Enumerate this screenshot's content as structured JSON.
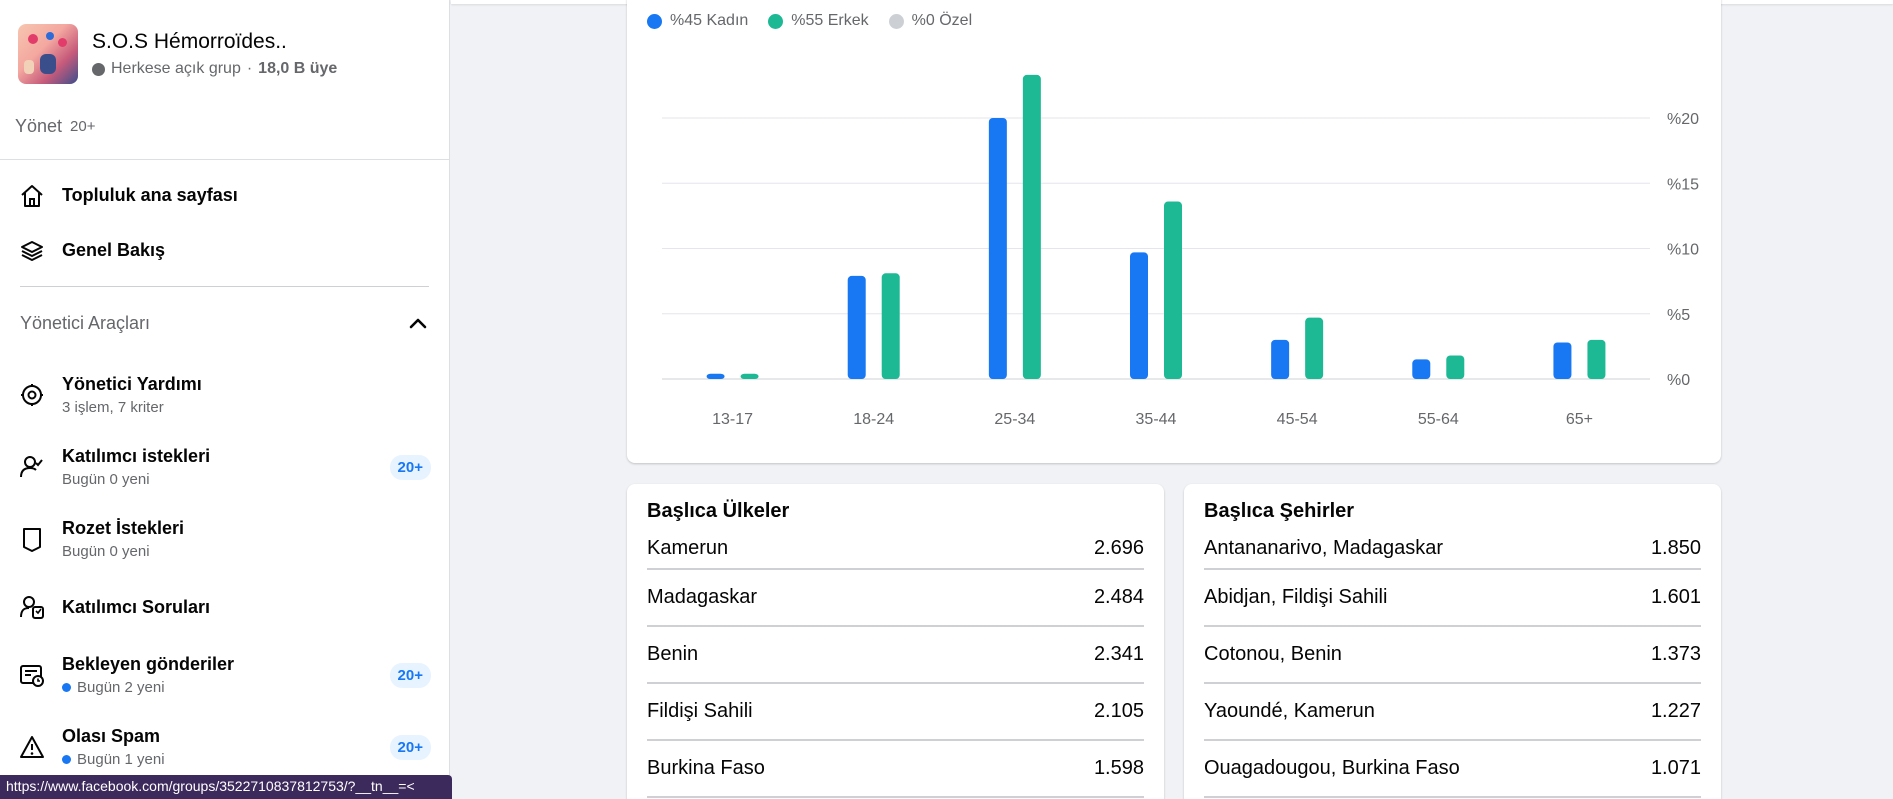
{
  "group": {
    "name": "S.O.S Hémorroïdes..",
    "privacy": "Herkese açık grup",
    "separator": "·",
    "members": "18,0 B üye"
  },
  "manage": {
    "label": "Yönet",
    "count": "20+"
  },
  "nav": [
    {
      "label": "Topluluk ana sayfası",
      "icon": "home-icon"
    },
    {
      "label": "Genel Bakış",
      "icon": "layers-icon"
    }
  ],
  "admin_tools": {
    "title": "Yönetici Araçları",
    "items": [
      {
        "title": "Yönetici Yardımı",
        "subtitle": "3 işlem, 7 kriter",
        "badge": "",
        "dot": false,
        "icon": "gear-icon"
      },
      {
        "title": "Katılımcı istekleri",
        "subtitle": "Bugün 0 yeni",
        "badge": "20+",
        "dot": false,
        "icon": "person-check-icon"
      },
      {
        "title": "Rozet İstekleri",
        "subtitle": "Bugün 0 yeni",
        "badge": "",
        "dot": false,
        "icon": "badge-icon"
      },
      {
        "title": "Katılımcı Soruları",
        "subtitle": "",
        "badge": "",
        "dot": false,
        "icon": "person-question-icon"
      },
      {
        "title": "Bekleyen gönderiler",
        "subtitle": "Bugün 2 yeni",
        "badge": "20+",
        "dot": true,
        "icon": "pending-posts-icon"
      },
      {
        "title": "Olası Spam",
        "subtitle": "Bugün 1 yeni",
        "badge": "20+",
        "dot": true,
        "icon": "warning-icon"
      }
    ]
  },
  "status_url": "https://www.facebook.com/groups/3522710837812753/?__tn__=<",
  "colors": {
    "female": "#1877f2",
    "male": "#1db994",
    "other": "#ccd0d5"
  },
  "chart_data": {
    "type": "bar",
    "categories": [
      "13-17",
      "18-24",
      "25-34",
      "35-44",
      "45-54",
      "55-64",
      "65+"
    ],
    "series": [
      {
        "name": "%45 Kadın",
        "values": [
          0.4,
          7.9,
          20.0,
          9.7,
          3.0,
          1.5,
          2.8
        ]
      },
      {
        "name": "%55 Erkek",
        "values": [
          0.4,
          8.1,
          23.3,
          13.6,
          4.7,
          1.8,
          3.0
        ]
      },
      {
        "name": "%0 Özel",
        "values": [
          0,
          0,
          0,
          0,
          0,
          0,
          0
        ]
      }
    ],
    "yticks": [
      "%0",
      "%5",
      "%10",
      "%15",
      "%20"
    ],
    "ylim": [
      0,
      25
    ],
    "grid": true,
    "legend": "top-left"
  },
  "countries": {
    "title": "Başlıca Ülkeler",
    "rows": [
      {
        "name": "Kamerun",
        "value": "2.696"
      },
      {
        "name": "Madagaskar",
        "value": "2.484"
      },
      {
        "name": "Benin",
        "value": "2.341"
      },
      {
        "name": "Fildişi Sahili",
        "value": "2.105"
      },
      {
        "name": "Burkina Faso",
        "value": "1.598"
      }
    ]
  },
  "cities": {
    "title": "Başlıca Şehirler",
    "rows": [
      {
        "name": "Antananarivo, Madagaskar",
        "value": "1.850"
      },
      {
        "name": "Abidjan, Fildişi Sahili",
        "value": "1.601"
      },
      {
        "name": "Cotonou, Benin",
        "value": "1.373"
      },
      {
        "name": "Yaoundé, Kamerun",
        "value": "1.227"
      },
      {
        "name": "Ouagadougou, Burkina Faso",
        "value": "1.071"
      }
    ]
  }
}
